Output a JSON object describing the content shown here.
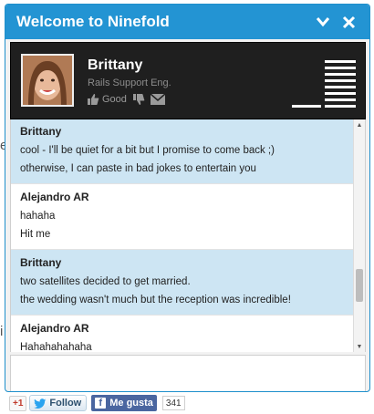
{
  "colors": {
    "header": "#2394d3",
    "agent_panel": "#1f1f1f",
    "agent_message_bg": "#cde5f3",
    "user_message_bg": "#ffffff"
  },
  "background_glyphs": [
    "e",
    "i"
  ],
  "widget": {
    "title": "Welcome to Ninefold",
    "minimize_icon": "chevron-down-icon",
    "close_icon": "close-icon"
  },
  "agent": {
    "name": "Brittany",
    "role": "Rails Support Eng.",
    "good_label": "Good"
  },
  "messages": [
    {
      "author": "Brittany",
      "kind": "agent",
      "lines": [
        "cool - I'll be quiet for a bit but I promise to come back ;)",
        "otherwise, I can paste in bad jokes to entertain you"
      ]
    },
    {
      "author": "Alejandro AR",
      "kind": "user",
      "lines": [
        "hahaha",
        "Hit me"
      ]
    },
    {
      "author": "Brittany",
      "kind": "agent",
      "lines": [
        "two satellites decided to get married.",
        "the wedding wasn't much but the reception was incredible!"
      ]
    },
    {
      "author": "Alejandro AR",
      "kind": "user",
      "lines": [
        "Hahahahahaha"
      ]
    }
  ],
  "social": {
    "gplus_label": "+1",
    "twitter_label": "Follow",
    "facebook_label": "Me gusta",
    "facebook_count": "341"
  }
}
